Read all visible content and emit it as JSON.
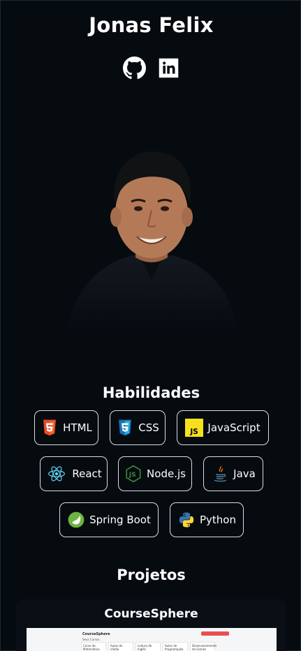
{
  "profile": {
    "name": "Jonas Felix",
    "socials": [
      {
        "name": "github",
        "icon": "github-icon"
      },
      {
        "name": "linkedin",
        "icon": "linkedin-icon"
      }
    ],
    "avatar_alt": "Jonas Felix"
  },
  "skills": {
    "title": "Habilidades",
    "items": [
      {
        "label": "HTML",
        "icon": "html5-icon",
        "color": "#e44d26"
      },
      {
        "label": "CSS",
        "icon": "css3-icon",
        "color": "#1572b6"
      },
      {
        "label": "JavaScript",
        "icon": "javascript-icon",
        "color": "#f7df1e"
      },
      {
        "label": "React",
        "icon": "react-icon",
        "color": "#61dafb"
      },
      {
        "label": "Node.js",
        "icon": "nodejs-icon",
        "color": "#3c873a"
      },
      {
        "label": "Java",
        "icon": "java-icon",
        "color": "#e76f00"
      },
      {
        "label": "Spring Boot",
        "icon": "spring-icon",
        "color": "#6db33f"
      },
      {
        "label": "Python",
        "icon": "python-icon",
        "color": "#3776ab"
      }
    ]
  },
  "projects": {
    "title": "Projetos",
    "items": [
      {
        "title": "CourseSphere",
        "preview": {
          "brand": "CourseSphere",
          "subtitle": "Seus Cursos",
          "cards": [
            "Curso de Matemática",
            "Aulas de Violão",
            "Leitura de Inglês",
            "Aulas de Programação",
            "Desenvolvimento de Games"
          ]
        }
      }
    ]
  },
  "colors": {
    "background": "#060b10",
    "text": "#ffffff",
    "border": "#d7dde2"
  }
}
